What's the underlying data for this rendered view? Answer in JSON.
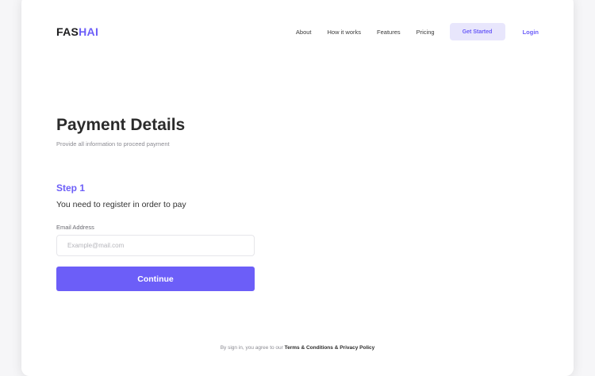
{
  "brand": {
    "part1": "FAS",
    "part2": "HAI",
    "accent_color": "#6c5ef8"
  },
  "nav": {
    "links": [
      "About",
      "How it works",
      "Features",
      "Pricing"
    ],
    "get_started": "Get Started",
    "login": "Login"
  },
  "page": {
    "title": "Payment Details",
    "subtitle": "Provide all information to proceed payment"
  },
  "step": {
    "label": "Step 1",
    "description": "You need to register in order to pay"
  },
  "form": {
    "email_label": "Email Address",
    "email_placeholder": "Example@mail.com",
    "email_value": "",
    "continue_label": "Continue"
  },
  "footer": {
    "prefix": "By sign in, you agree to our ",
    "terms": "Terms & Conditions & Privacy Policy"
  }
}
